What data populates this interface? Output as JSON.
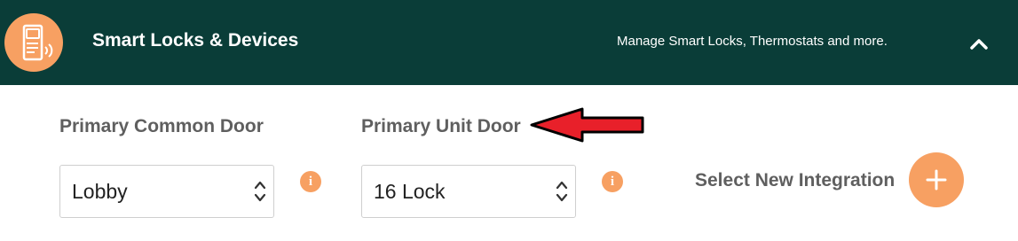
{
  "header": {
    "title": "Smart Locks & Devices",
    "subtitle": "Manage Smart Locks, Thermostats and more.",
    "logo_icon": "smart-lock-icon",
    "collapse_icon": "chevron-up-icon",
    "background_color": "#0a3d38",
    "accent_color": "#f7a062"
  },
  "fields": {
    "common_door": {
      "label": "Primary Common Door",
      "value": "Lobby",
      "info_icon": "info-icon"
    },
    "unit_door": {
      "label": "Primary Unit Door",
      "value": "16 Lock",
      "info_icon": "info-icon"
    }
  },
  "integration": {
    "label": "Select New Integration",
    "button_icon": "plus-icon"
  },
  "annotation": {
    "arrow_color": "#e8202a",
    "arrow_icon": "red-arrow-left-icon"
  }
}
